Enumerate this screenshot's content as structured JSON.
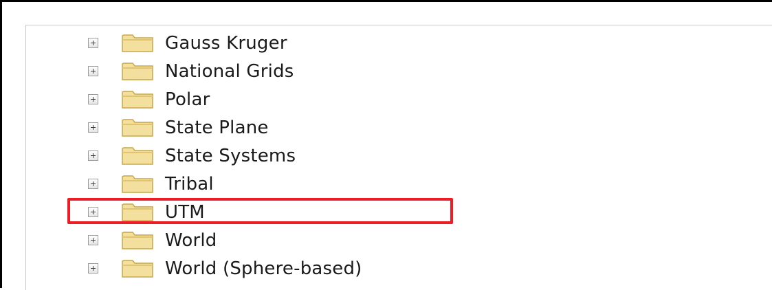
{
  "tree": {
    "items": [
      {
        "label": "Gauss Kruger",
        "expander_icon": "plus-box-icon",
        "icon": "folder-icon"
      },
      {
        "label": "National Grids",
        "expander_icon": "plus-box-icon",
        "icon": "folder-icon"
      },
      {
        "label": "Polar",
        "expander_icon": "plus-box-icon",
        "icon": "folder-icon"
      },
      {
        "label": "State Plane",
        "expander_icon": "plus-box-icon",
        "icon": "folder-icon"
      },
      {
        "label": "State Systems",
        "expander_icon": "plus-box-icon",
        "icon": "folder-icon"
      },
      {
        "label": "Tribal",
        "expander_icon": "plus-box-icon",
        "icon": "folder-icon"
      },
      {
        "label": "UTM",
        "expander_icon": "plus-box-icon",
        "icon": "folder-icon",
        "highlighted": true
      },
      {
        "label": "World",
        "expander_icon": "plus-box-icon",
        "icon": "folder-icon"
      },
      {
        "label": "World (Sphere-based)",
        "expander_icon": "plus-box-icon",
        "icon": "folder-icon"
      }
    ]
  },
  "colors": {
    "highlight_border": "#ee1c24",
    "folder_fill": "#f3df9e",
    "folder_outline": "#c9a74a"
  }
}
